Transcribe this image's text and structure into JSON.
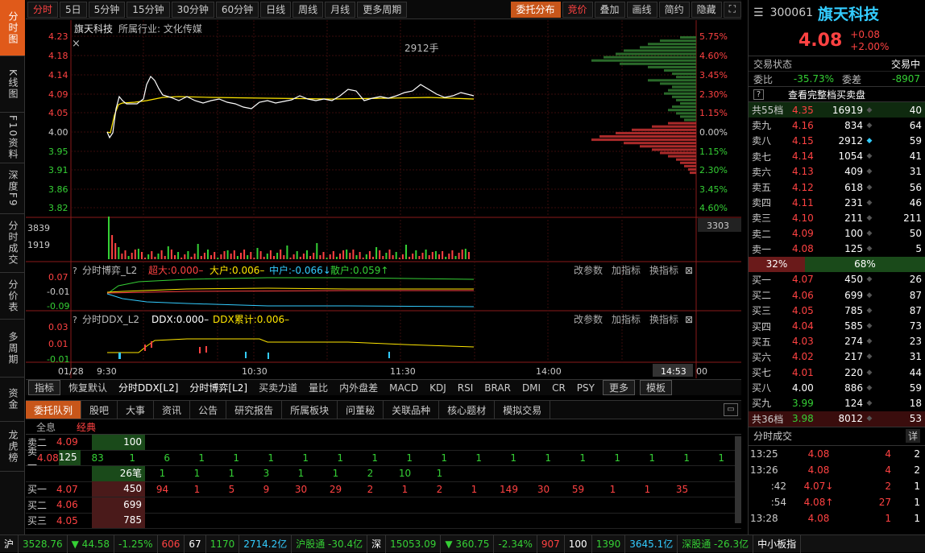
{
  "leftnav": [
    "分时图",
    "K线图",
    "F10资料",
    "深度F9",
    "分时成交",
    "分价表",
    "多周期",
    "资金",
    "龙虎榜"
  ],
  "toolbar": {
    "items": [
      "分时",
      "5日",
      "5分钟",
      "15分钟",
      "30分钟",
      "60分钟",
      "日线",
      "周线",
      "月线",
      "更多周期"
    ],
    "right": [
      "委托分布",
      "竞价",
      "叠加",
      "画线",
      "简约",
      "隐藏"
    ]
  },
  "chart": {
    "name": "旗天科技",
    "industry": "所属行业: 文化传媒",
    "vol_label": "2912手",
    "left_ticks": [
      "4.23",
      "4.18",
      "4.14",
      "4.09",
      "4.05",
      "4.00",
      "3.95",
      "3.91",
      "3.86",
      "3.82"
    ],
    "right_ticks": [
      "5.75%",
      "4.60%",
      "3.45%",
      "2.30%",
      "1.15%",
      "0.00%",
      "1.15%",
      "2.30%",
      "3.45%",
      "4.60%"
    ],
    "vol_ticks": [
      "3839",
      "1919"
    ],
    "vol_right": "3303",
    "time_labels": [
      "01/28",
      "9:30",
      "10:30",
      "11:30",
      "14:00",
      "14:53",
      "00"
    ],
    "panel1": {
      "title": "分时博弈_L2",
      "a": "超大:0.000–",
      "b": "大户:0.006–",
      "c": "中户:-0.066↓",
      "d": "散户:0.059↑",
      "ticks": [
        "0.07",
        "-0.01",
        "-0.09"
      ],
      "btns": [
        "改参数",
        "加指标",
        "换指标"
      ]
    },
    "panel2": {
      "title": "分时DDX_L2",
      "a": "DDX:0.000–",
      "b": "DDX累计:0.006–",
      "ticks": [
        "0.03",
        "0.01",
        "-0.01"
      ],
      "btns": [
        "改参数",
        "加指标",
        "换指标"
      ]
    }
  },
  "indtabs": [
    "指标",
    "恢复默认",
    "分时DDX[L2]",
    "分时博弈[L2]",
    "买卖力道",
    "量比",
    "内外盘差",
    "MACD",
    "KDJ",
    "RSI",
    "BRAR",
    "DMI",
    "CR",
    "PSY",
    "更多",
    "模板"
  ],
  "btabs": [
    "委托队列",
    "股吧",
    "大事",
    "资讯",
    "公告",
    "研究报告",
    "所属板块",
    "问董秘",
    "关联品种",
    "核心题材",
    "模拟交易"
  ],
  "queue": {
    "sub": [
      "全息",
      "经典"
    ],
    "rows": [
      {
        "label": "卖二",
        "price": "4.09",
        "vol": "100",
        "items": []
      },
      {
        "label": "卖一",
        "price": "4.08",
        "vol": "125",
        "items": [
          "83",
          "1",
          "6",
          "1",
          "1",
          "1",
          "1",
          "1",
          "1",
          "1",
          "1",
          "1",
          "1",
          "1",
          "1",
          "1",
          "1",
          "1",
          "1",
          "1",
          "1"
        ]
      },
      {
        "label": "",
        "price": "",
        "vol": "26笔",
        "items": [
          "1",
          "1",
          "1",
          "3",
          "1",
          "1",
          "2",
          "10",
          "1"
        ]
      },
      {
        "label": "买一",
        "price": "4.07",
        "vol": "450",
        "items": [
          "94",
          "1",
          "5",
          "9",
          "30",
          "29",
          "2",
          "1",
          "2",
          "1",
          "149",
          "30",
          "59",
          "1",
          "1",
          "35"
        ]
      },
      {
        "label": "买二",
        "price": "4.06",
        "vol": "699",
        "items": []
      },
      {
        "label": "买三",
        "price": "4.05",
        "vol": "785",
        "items": []
      }
    ]
  },
  "quote": {
    "code": "300061",
    "name": "旗天科技",
    "price": "4.08",
    "chg": "+0.08",
    "pct": "+2.00%",
    "state_label": "交易状态",
    "state": "交易中",
    "wb_label": "委比",
    "wb": "-35.73%",
    "wc_label": "委差",
    "wc": "-8907",
    "fullbook": "查看完整档买卖盘",
    "sell_total": {
      "label": "共55档",
      "price": "4.35",
      "vol": "16919",
      "n": "40"
    },
    "sells": [
      {
        "label": "卖九",
        "price": "4.16",
        "vol": "834",
        "n": "64"
      },
      {
        "label": "卖八",
        "price": "4.15",
        "vol": "2912",
        "n": "59"
      },
      {
        "label": "卖七",
        "price": "4.14",
        "vol": "1054",
        "n": "41"
      },
      {
        "label": "卖六",
        "price": "4.13",
        "vol": "409",
        "n": "31"
      },
      {
        "label": "卖五",
        "price": "4.12",
        "vol": "618",
        "n": "56"
      },
      {
        "label": "卖四",
        "price": "4.11",
        "vol": "231",
        "n": "46"
      },
      {
        "label": "卖三",
        "price": "4.10",
        "vol": "211",
        "n": "211"
      },
      {
        "label": "卖二",
        "price": "4.09",
        "vol": "100",
        "n": "50"
      },
      {
        "label": "卖一",
        "price": "4.08",
        "vol": "125",
        "n": "5"
      }
    ],
    "ratio_left": "32%",
    "ratio_right": "68%",
    "buys": [
      {
        "label": "买一",
        "price": "4.07",
        "vol": "450",
        "n": "26"
      },
      {
        "label": "买二",
        "price": "4.06",
        "vol": "699",
        "n": "87"
      },
      {
        "label": "买三",
        "price": "4.05",
        "vol": "785",
        "n": "87"
      },
      {
        "label": "买四",
        "price": "4.04",
        "vol": "585",
        "n": "73"
      },
      {
        "label": "买五",
        "price": "4.03",
        "vol": "274",
        "n": "23"
      },
      {
        "label": "买六",
        "price": "4.02",
        "vol": "217",
        "n": "31"
      },
      {
        "label": "买七",
        "price": "4.01",
        "vol": "220",
        "n": "44"
      },
      {
        "label": "买八",
        "price": "4.00",
        "vol": "886",
        "n": "59"
      },
      {
        "label": "买九",
        "price": "3.99",
        "vol": "124",
        "n": "18"
      }
    ],
    "buy_total": {
      "label": "共36档",
      "price": "3.98",
      "vol": "8012",
      "n": "53"
    },
    "trades_title": "分时成交",
    "trades_btn": "详",
    "trades": [
      {
        "t": "13:25",
        "p": "4.08",
        "v": "4",
        "n": "2",
        "c": "red"
      },
      {
        "t": "13:26",
        "p": "4.08",
        "v": "4",
        "n": "2",
        "c": "red"
      },
      {
        "t": ":42",
        "p": "4.07↓",
        "v": "2",
        "n": "1",
        "c": "red"
      },
      {
        "t": ":54",
        "p": "4.08↑",
        "v": "27",
        "n": "1",
        "c": "red"
      },
      {
        "t": "13:28",
        "p": "4.08",
        "v": "1",
        "n": "1",
        "c": "red"
      }
    ]
  },
  "status": {
    "sh": "沪",
    "sh_idx": "3528.76",
    "sh_chg": "▼ 44.58",
    "sh_pct": "-1.25%",
    "sh_up": "606",
    "sh_flat": "67",
    "sh_dn": "1170",
    "sh_amt": "2714.2亿",
    "hgt": "沪股通 -30.4亿",
    "sz": "深",
    "sz_idx": "15053.09",
    "sz_chg": "▼ 360.75",
    "sz_pct": "-2.34%",
    "sz_up": "907",
    "sz_flat": "100",
    "sz_dn": "1390",
    "sz_amt": "3645.1亿",
    "sgt": "深股通 -26.3亿",
    "board": "中小板指"
  }
}
